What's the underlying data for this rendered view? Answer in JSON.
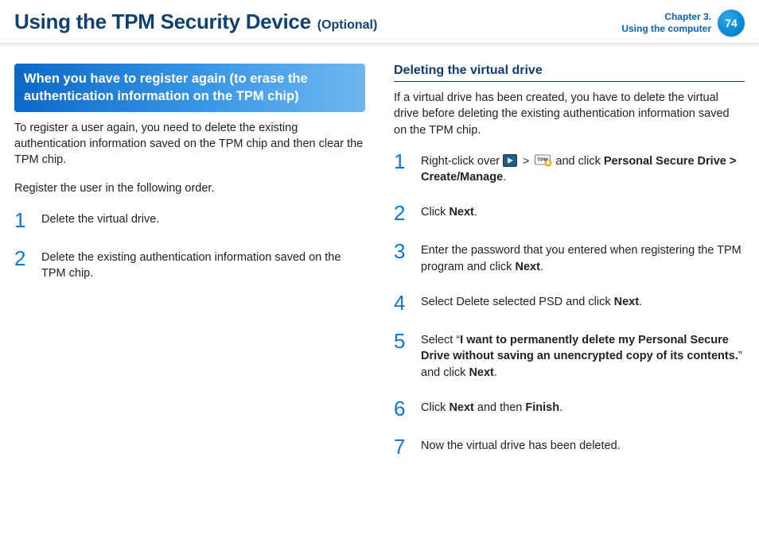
{
  "header": {
    "title": "Using the TPM Security Device",
    "subtitle": "(Optional)",
    "chapter_line1": "Chapter 3.",
    "chapter_line2": "Using the computer",
    "page_number": "74"
  },
  "left": {
    "callout": "When you have to register again (to erase the authentication information on the TPM chip)",
    "para1": "To register a user again, you need to delete the existing authentication information saved on the TPM chip and then clear the TPM chip.",
    "para2": "Register the user in the following order.",
    "steps": [
      "Delete the virtual drive.",
      "Delete the existing authentication information saved on the TPM chip."
    ]
  },
  "right": {
    "heading": "Deleting the virtual drive",
    "intro": "If a virtual drive has been created, you have to delete the virtual drive before deleting the existing authentication information saved on the TPM chip.",
    "steps": {
      "s1_a": "Right-click over ",
      "s1_b": " and click ",
      "s1_bold1": "Personal Secure Drive > Create/Manage",
      "s1_c": ".",
      "s2_a": "Click ",
      "s2_bold": "Next",
      "s2_b": ".",
      "s3_a": "Enter the password that you entered when registering the TPM program and click ",
      "s3_bold": "Next",
      "s3_b": ".",
      "s4_a": "Select Delete selected PSD and click ",
      "s4_bold": "Next",
      "s4_b": ".",
      "s5_a": "Select “",
      "s5_bold": "I want to permanently delete my Personal Secure Drive without saving an unencrypted copy of its contents.",
      "s5_b": "” and click ",
      "s5_bold2": "Next",
      "s5_c": ".",
      "s6_a": "Click ",
      "s6_bold1": "Next",
      "s6_b": " and then ",
      "s6_bold2": "Finish",
      "s6_c": ".",
      "s7": "Now the virtual drive has been deleted."
    },
    "gt": ">"
  }
}
